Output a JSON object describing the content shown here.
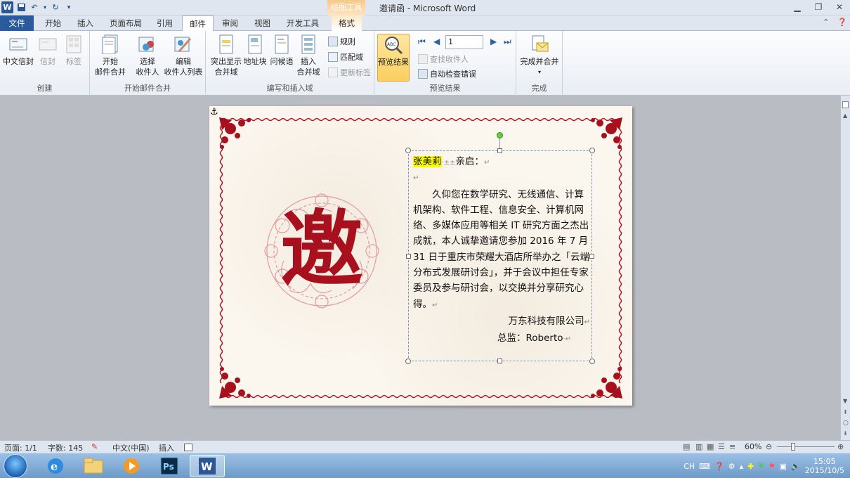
{
  "window": {
    "title": "邀请函 - Microsoft Word",
    "context_tab_group": "绘图工具"
  },
  "tabs": [
    {
      "label": "文件"
    },
    {
      "label": "开始"
    },
    {
      "label": "插入"
    },
    {
      "label": "页面布局"
    },
    {
      "label": "引用"
    },
    {
      "label": "邮件"
    },
    {
      "label": "审阅"
    },
    {
      "label": "视图"
    },
    {
      "label": "开发工具"
    },
    {
      "label": "格式"
    }
  ],
  "ribbon": {
    "groups": {
      "create": "创建",
      "start_merge": "开始邮件合并",
      "write_insert": "编写和插入域",
      "preview": "预览结果",
      "finish": "完成"
    },
    "buttons": {
      "chinese_envelope": "中文信封",
      "envelope": "信封",
      "labels": "标签",
      "start_merge_1": "开始",
      "start_merge_2": "邮件合并",
      "select_recipients_1": "选择",
      "select_recipients_2": "收件人",
      "edit_list_1": "编辑",
      "edit_list_2": "收件人列表",
      "highlight_fields_1": "突出显示",
      "highlight_fields_2": "合并域",
      "address_block": "地址块",
      "greeting_line": "问候语",
      "insert_field_1": "插入",
      "insert_field_2": "合并域",
      "rules": "规则",
      "match_fields": "匹配域",
      "update_labels": "更新标签",
      "preview_results": "预览结果",
      "record_number": "1",
      "find_recipient": "查找收件人",
      "auto_check": "自动检查错误",
      "finish_merge": "完成并合并"
    }
  },
  "document": {
    "big_char": "邀",
    "recipient_name": "张美莉",
    "salutation": "亲启：",
    "body": "久仰您在数学研究、无线通信、计算机架构、软件工程、信息安全、计算机网络、多媒体应用等相关 IT 研究方面之杰出成就，本人诚挚邀请您参加 2016 年 7 月 31 日于重庆市荣耀大酒店所举办之「云端分布式发展研讨会」，并于会议中担任专家委员及参与研讨会，以交换并分享研究心得。",
    "company": "万东科技有限公司",
    "signature": "总监：Roberto"
  },
  "statusbar": {
    "page": "页面: 1/1",
    "words": "字数: 145",
    "language": "中文(中国)",
    "mode": "插入",
    "zoom": "60%"
  },
  "taskbar": {
    "ime": "CH",
    "time": "15:05",
    "date": "2015/10/5"
  },
  "colors": {
    "accent": "#2a5b9f",
    "border_red": "#b0182a",
    "highlight": "#ffff00"
  }
}
